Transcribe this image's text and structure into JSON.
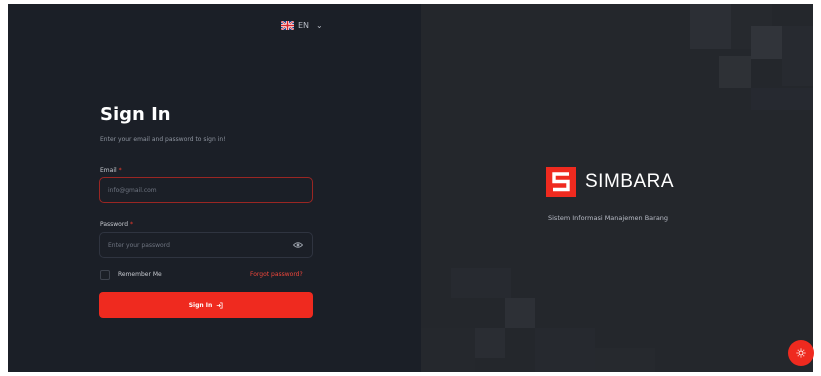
{
  "language": {
    "flag": "uk-flag-icon",
    "code": "EN",
    "chevron": "chevron-down-icon"
  },
  "form": {
    "title": "Sign In",
    "subtitle": "Enter your email and password to sign in!",
    "email": {
      "label": "Email",
      "required_mark": "*",
      "value": "",
      "placeholder": "info@gmail.com"
    },
    "password": {
      "label": "Password",
      "required_mark": "*",
      "value": "",
      "placeholder": "Enter your password",
      "toggle_icon": "eye-icon"
    },
    "remember": {
      "label": "Remember Me",
      "checked": false
    },
    "forgot_link": "Forgot password?",
    "submit": {
      "label": "Sign In",
      "icon": "sign-in-icon"
    }
  },
  "brand": {
    "name": "SIMBARA",
    "tagline": "Sistem Informasi Manajemen Barang",
    "logo_icon": "simbara-logo-icon"
  },
  "theme_toggle": {
    "icon": "sun-icon"
  },
  "colors": {
    "accent": "#ef2a1f",
    "left_panel": "#1b1f27",
    "right_panel": "#24272c",
    "text_primary": "#ffffff",
    "text_muted": "#8d939e"
  }
}
